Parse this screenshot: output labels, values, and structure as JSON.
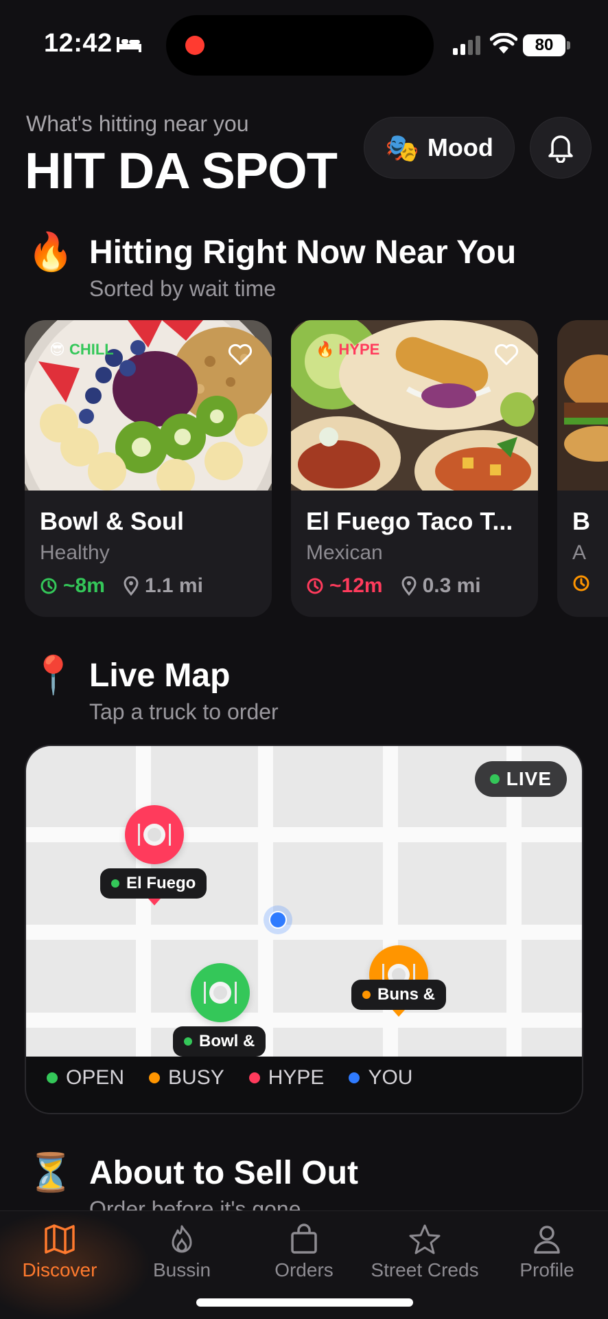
{
  "status_bar": {
    "time": "12:42",
    "battery": "80"
  },
  "header": {
    "subtitle": "What's hitting near you",
    "title": "HIT DA SPOT",
    "mood_label": "Mood",
    "mood_icon": "🎭"
  },
  "section_hitting": {
    "emoji": "🔥",
    "title": "Hitting Right Now Near You",
    "subtitle": "Sorted by wait time"
  },
  "cards": [
    {
      "tag_emoji": "😎",
      "tag": "CHILL",
      "tag_color": "#34c759",
      "name": "Bowl & Soul",
      "category": "Healthy",
      "wait": "~8m",
      "wait_color": "#34c759",
      "distance": "1.1 mi"
    },
    {
      "tag_emoji": "🔥",
      "tag": "HYPE",
      "tag_color": "#ff3b5c",
      "name": "El Fuego Taco T...",
      "category": "Mexican",
      "wait": "~12m",
      "wait_color": "#ff3b5c",
      "distance": "0.3 mi"
    },
    {
      "name": "B",
      "category": "A",
      "wait_color": "#ff9500"
    }
  ],
  "section_map": {
    "emoji": "📍",
    "title": "Live Map",
    "subtitle": "Tap a truck to order"
  },
  "map": {
    "live_label": "LIVE",
    "pins": [
      {
        "label": "El Fuego",
        "color": "#ff3b5c"
      },
      {
        "label": "Bowl &",
        "color": "#34c759"
      },
      {
        "label": "Buns &",
        "color": "#ff9500"
      }
    ],
    "legend": [
      {
        "label": "OPEN",
        "color": "#34c759"
      },
      {
        "label": "BUSY",
        "color": "#ff9500"
      },
      {
        "label": "HYPE",
        "color": "#ff3b5c"
      },
      {
        "label": "YOU",
        "color": "#2f7bff"
      }
    ]
  },
  "section_sellout": {
    "emoji": "⏳",
    "title": "About to Sell Out",
    "subtitle": "Order before it's gone"
  },
  "nav": {
    "items": [
      {
        "label": "Discover",
        "icon": "map-icon"
      },
      {
        "label": "Bussin",
        "icon": "flame-icon"
      },
      {
        "label": "Orders",
        "icon": "bag-icon"
      },
      {
        "label": "Street Creds",
        "icon": "star-icon"
      },
      {
        "label": "Profile",
        "icon": "person-icon"
      }
    ],
    "active_color": "#ff7a2e"
  }
}
